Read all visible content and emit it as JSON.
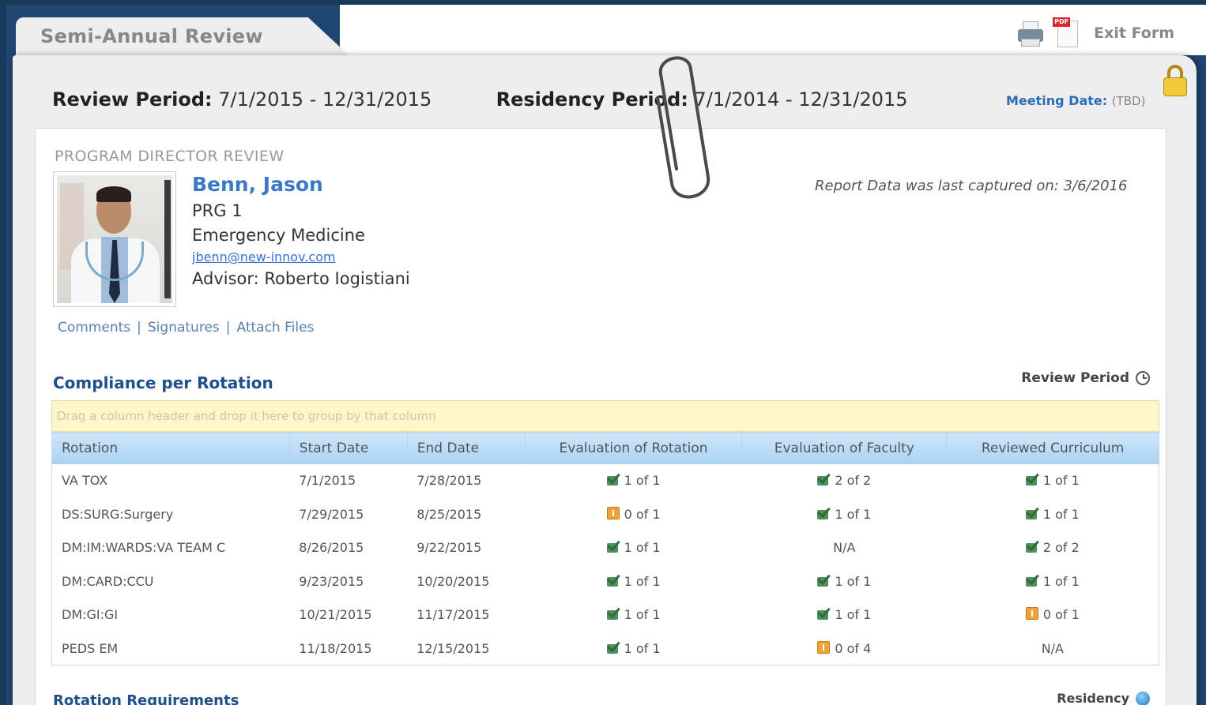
{
  "tab": {
    "title": "Semi-Annual Review"
  },
  "top_actions": {
    "exit_label": "Exit Form",
    "pdf_badge": "PDF"
  },
  "header": {
    "review_period_label": "Review Period:",
    "review_period_value": "7/1/2015 - 12/31/2015",
    "residency_period_label": "Residency Period:",
    "residency_period_value": "7/1/2014 - 12/31/2015",
    "meeting_label": "Meeting Date:",
    "meeting_value": "(TBD)"
  },
  "review": {
    "section_label": "PROGRAM DIRECTOR REVIEW",
    "name": "Benn, Jason",
    "level": "PRG 1",
    "specialty": "Emergency Medicine",
    "email": "jbenn@new-innov.com",
    "advisor": "Advisor: Roberto Iogistiani",
    "report_note": "Report Data was last captured on: 3/6/2016",
    "links": [
      "Comments",
      "Signatures",
      "Attach Files"
    ]
  },
  "compliance": {
    "title": "Compliance per Rotation",
    "period_link": "Review Period",
    "group_hint": "Drag a column header and drop it here to group by that column",
    "columns": [
      "Rotation",
      "Start Date",
      "End Date",
      "Evaluation of Rotation",
      "Evaluation of Faculty",
      "Reviewed Curriculum"
    ],
    "rows": [
      {
        "rotation": "VA TOX",
        "start": "7/1/2015",
        "end": "7/28/2015",
        "eval_rotation": {
          "status": "check",
          "text": "1 of 1"
        },
        "eval_faculty": {
          "status": "check",
          "text": "2 of 2"
        },
        "curriculum": {
          "status": "check",
          "text": "1 of 1"
        }
      },
      {
        "rotation": "DS:SURG:Surgery",
        "start": "7/29/2015",
        "end": "8/25/2015",
        "eval_rotation": {
          "status": "warn",
          "text": "0 of 1"
        },
        "eval_faculty": {
          "status": "check",
          "text": "1 of 1"
        },
        "curriculum": {
          "status": "check",
          "text": "1 of 1"
        }
      },
      {
        "rotation": "DM:IM:WARDS:VA TEAM C",
        "start": "8/26/2015",
        "end": "9/22/2015",
        "eval_rotation": {
          "status": "check",
          "text": "1 of 1"
        },
        "eval_faculty": {
          "status": "none",
          "text": "N/A"
        },
        "curriculum": {
          "status": "check",
          "text": "2 of 2"
        }
      },
      {
        "rotation": "DM:CARD:CCU",
        "start": "9/23/2015",
        "end": "10/20/2015",
        "eval_rotation": {
          "status": "check",
          "text": "1 of 1"
        },
        "eval_faculty": {
          "status": "check",
          "text": "1 of 1"
        },
        "curriculum": {
          "status": "check",
          "text": "1 of 1"
        }
      },
      {
        "rotation": "DM:GI:GI",
        "start": "10/21/2015",
        "end": "11/17/2015",
        "eval_rotation": {
          "status": "check",
          "text": "1 of 1"
        },
        "eval_faculty": {
          "status": "check",
          "text": "1 of 1"
        },
        "curriculum": {
          "status": "warn",
          "text": "0 of 1"
        }
      },
      {
        "rotation": "PEDS EM",
        "start": "11/18/2015",
        "end": "12/15/2015",
        "eval_rotation": {
          "status": "check",
          "text": "1 of 1"
        },
        "eval_faculty": {
          "status": "warn",
          "text": "0 of 4"
        },
        "curriculum": {
          "status": "none",
          "text": "N/A"
        }
      }
    ]
  },
  "requirements": {
    "title": "Rotation Requirements",
    "scope_link": "Residency"
  }
}
